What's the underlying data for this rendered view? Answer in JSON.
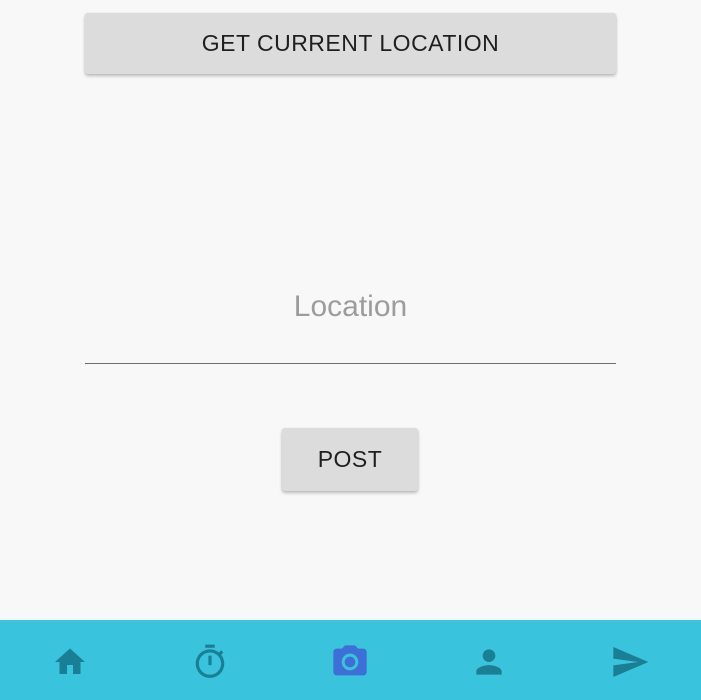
{
  "actions": {
    "get_location_label": "GET CURRENT LOCATION",
    "post_label": "POST"
  },
  "location": {
    "placeholder": "Location",
    "value": ""
  },
  "bottom_nav": {
    "background_color": "#3ac3dc",
    "icon_color": "#1a7e95",
    "active_icon_color": "#3d6fd6",
    "items": [
      {
        "icon": "home-icon",
        "active": false
      },
      {
        "icon": "timer-icon",
        "active": false
      },
      {
        "icon": "camera-icon",
        "active": true
      },
      {
        "icon": "person-icon",
        "active": false
      },
      {
        "icon": "send-icon",
        "active": false
      }
    ]
  }
}
